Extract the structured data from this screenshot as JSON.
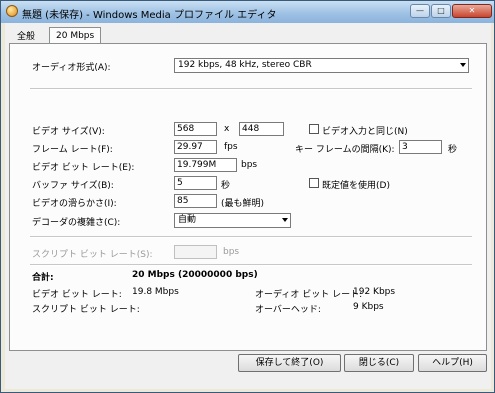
{
  "window": {
    "title": "無題 (未保存) - Windows Media プロファイル エディタ",
    "minimize_glyph": "—",
    "maximize_glyph": "□",
    "close_glyph": "✕"
  },
  "tabs": [
    {
      "label": "全般",
      "active": false
    },
    {
      "label": "20 Mbps",
      "active": true
    }
  ],
  "audio": {
    "format_label": "オーディオ形式(A):",
    "format_value": "192 kbps, 48 kHz, stereo CBR"
  },
  "video": {
    "size_label": "ビデオ サイズ(V):",
    "width": "568",
    "size_sep": "x",
    "height": "448",
    "same_as_input_label": "ビデオ入力と同じ(N)",
    "frame_rate_label": "フレーム レート(F):",
    "frame_rate": "29.97",
    "fps_unit": "fps",
    "keyframe_label": "キー フレームの間隔(K):",
    "keyframe": "3",
    "sec_unit": "秒",
    "bitrate_label": "ビデオ ビット レート(E):",
    "bitrate": "19.799M",
    "bps_unit": "bps",
    "buffer_label": "バッファ サイズ(B):",
    "buffer": "5",
    "buffer_unit": "秒",
    "default_label": "既定値を使用(D)",
    "smoothness_label": "ビデオの滑らかさ(I):",
    "smoothness": "85",
    "smoothness_note": "(最も鮮明)",
    "decoder_label": "デコーダの複雑さ(C):",
    "decoder_value": "自動"
  },
  "script": {
    "bitrate_label": "スクリプト ビット レート(S):",
    "bitrate": "",
    "bps_unit": "bps"
  },
  "summary": {
    "total_label": "合計:",
    "total_value": "20 Mbps (20000000 bps)",
    "video_label": "ビデオ ビット レート:",
    "video_value": "19.8 Mbps",
    "audio_label": "オーディオ ビット レート:",
    "audio_value": "192 Kbps",
    "script_label": "スクリプト ビット レート:",
    "script_value": "",
    "overhead_label": "オーバーヘッド:",
    "overhead_value": "9 Kbps"
  },
  "buttons": {
    "save": "保存して終了(O)",
    "close": "閉じる(C)",
    "help": "ヘルプ(H)"
  }
}
